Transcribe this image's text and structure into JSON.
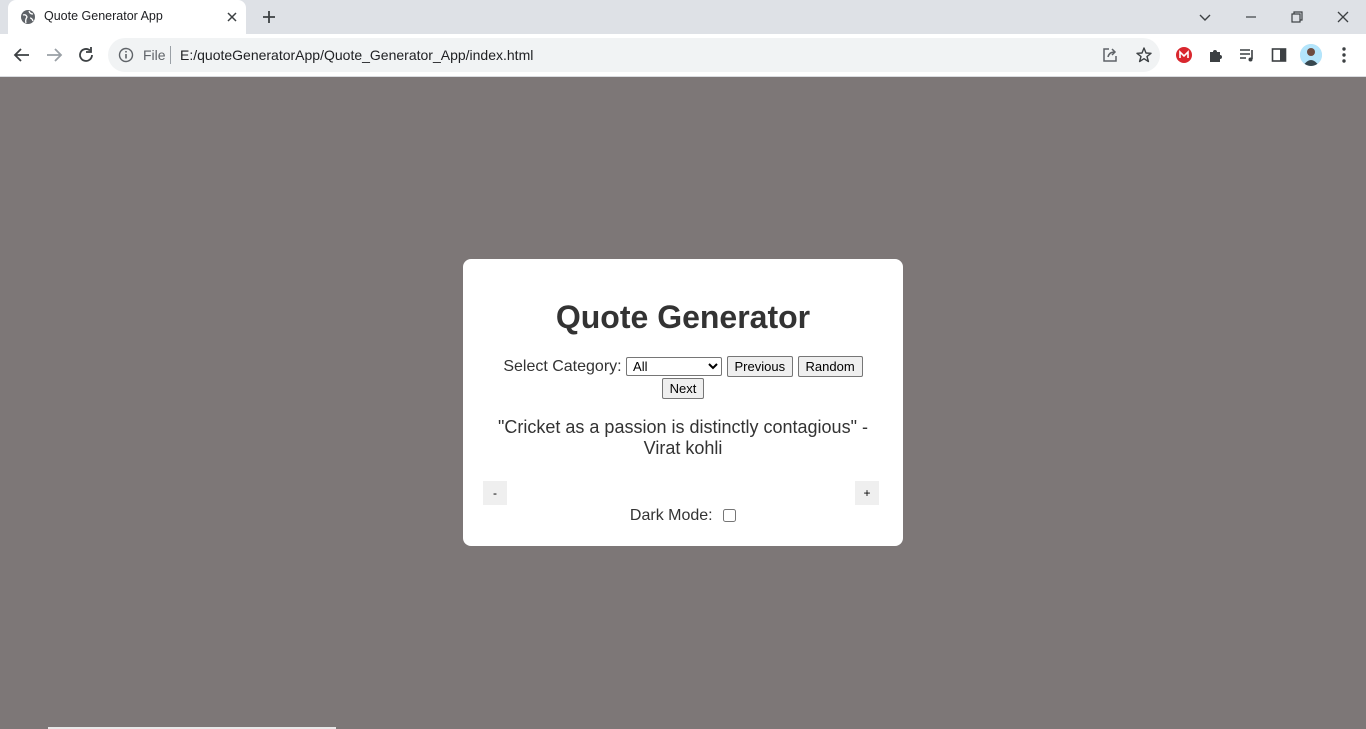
{
  "browser": {
    "tab_title": "Quote Generator App",
    "address_scheme": "File",
    "address_url": "E:/quoteGeneratorApp/Quote_Generator_App/index.html"
  },
  "app": {
    "title": "Quote Generator",
    "category_label": "Select Category:",
    "category_selected": "All",
    "previous_label": "Previous",
    "random_label": "Random",
    "next_label": "Next",
    "quote_text": "\"Cricket as a passion is distinctly contagious\"",
    "quote_dash": "-",
    "quote_author": "Virat kohli",
    "decrease_label": "-",
    "increase_label": "+",
    "dark_mode_label": "Dark Mode:",
    "dark_mode_checked": false
  },
  "colors": {
    "page_background": "#7d7777",
    "card_background": "#ffffff",
    "text": "#333333"
  },
  "icons": [
    "globe-icon",
    "close-icon",
    "plus-icon",
    "chevron-down-icon",
    "minimize-icon",
    "restore-icon",
    "back-arrow-icon",
    "forward-arrow-icon",
    "reload-icon",
    "info-icon",
    "share-icon",
    "star-icon",
    "mega-extension-icon",
    "puzzle-extensions-icon",
    "reading-list-icon",
    "side-panel-icon",
    "avatar",
    "kebab-menu-icon"
  ]
}
